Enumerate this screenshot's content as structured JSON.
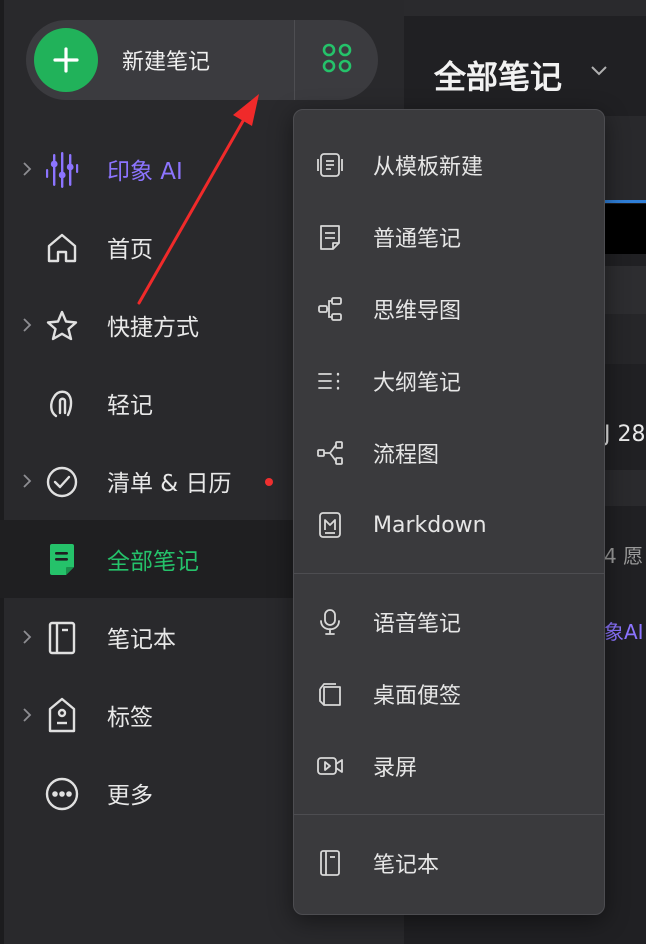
{
  "new_note": {
    "label": "新建笔记"
  },
  "nav": {
    "items": [
      {
        "label": "印象 AI",
        "icon": "sparkle-ai-icon",
        "has_chevron": true
      },
      {
        "label": "首页",
        "icon": "home-icon",
        "has_chevron": false
      },
      {
        "label": "快捷方式",
        "icon": "star-icon",
        "has_chevron": true
      },
      {
        "label": "轻记",
        "icon": "paperclip-icon",
        "has_chevron": false
      },
      {
        "label": "清单 & 日历",
        "icon": "check-circle-icon",
        "has_chevron": true,
        "badge": "red-dot"
      },
      {
        "label": "全部笔记",
        "icon": "note-icon",
        "has_chevron": false,
        "active": true
      },
      {
        "label": "笔记本",
        "icon": "notebook-icon",
        "has_chevron": true
      },
      {
        "label": "标签",
        "icon": "tag-icon",
        "has_chevron": true
      },
      {
        "label": "更多",
        "icon": "more-icon",
        "has_chevron": false
      }
    ]
  },
  "main": {
    "title": "全部笔记",
    "fragment_1": "J 28",
    "fragment_2": "4 愿",
    "fragment_3": "象AI"
  },
  "dropdown": {
    "items": [
      {
        "label": "从模板新建",
        "icon": "template-icon"
      },
      {
        "label": "普通笔记",
        "icon": "note-icon"
      },
      {
        "label": "思维导图",
        "icon": "mindmap-icon"
      },
      {
        "label": "大纲笔记",
        "icon": "outline-icon"
      },
      {
        "label": "流程图",
        "icon": "flowchart-icon"
      },
      {
        "label": "Markdown",
        "icon": "markdown-icon"
      },
      {
        "label": "语音笔记",
        "icon": "microphone-icon"
      },
      {
        "label": "桌面便签",
        "icon": "sticky-note-icon"
      },
      {
        "label": "录屏",
        "icon": "video-camera-icon"
      },
      {
        "label": "笔记本",
        "icon": "notebook-icon"
      }
    ]
  },
  "colors": {
    "accent_green": "#21b25a",
    "ai_purple": "#8c74ff",
    "annotation_red": "#f02a2a",
    "badge_red": "#f03030"
  }
}
